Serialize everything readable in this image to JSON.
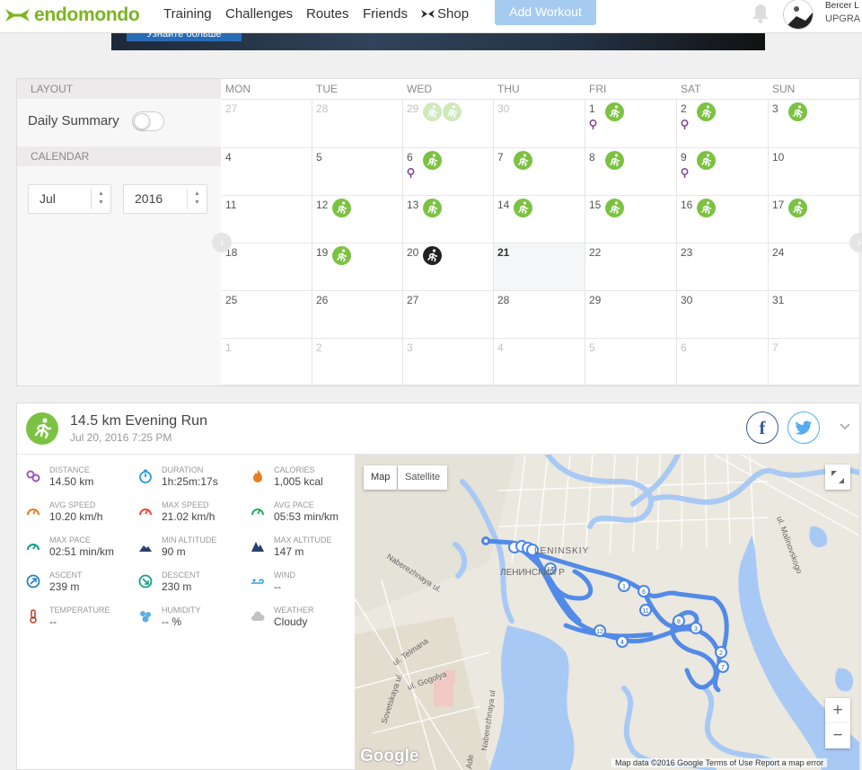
{
  "nav": {
    "brand": "endomondo",
    "links": [
      "Training",
      "Challenges",
      "Routes",
      "Friends"
    ],
    "shop": "Shop",
    "add_workout": "Add Workout",
    "user_name": "Bercer L",
    "user_upgrade": "UPGRA"
  },
  "banner": {
    "button_label": "Узнайте больше"
  },
  "calendar": {
    "layout_heading": "LAYOUT",
    "daily_summary_label": "Daily Summary",
    "daily_summary_on": false,
    "calendar_heading": "CALENDAR",
    "month": "Jul",
    "year": "2016",
    "weekdays": [
      "MON",
      "TUE",
      "WED",
      "THU",
      "FRI",
      "SAT",
      "SUN"
    ],
    "weeks": [
      [
        {
          "d": "27",
          "dim": true
        },
        {
          "d": "28",
          "dim": true
        },
        {
          "d": "29",
          "dim": true,
          "w": 2,
          "faded": true
        },
        {
          "d": "30",
          "dim": true
        },
        {
          "d": "1",
          "w": 1,
          "pin": true
        },
        {
          "d": "2",
          "w": 1,
          "pin": true
        },
        {
          "d": "3",
          "w": 1
        }
      ],
      [
        {
          "d": "4"
        },
        {
          "d": "5"
        },
        {
          "d": "6",
          "w": 1,
          "pin": true
        },
        {
          "d": "7",
          "w": 1
        },
        {
          "d": "8",
          "w": 1
        },
        {
          "d": "9",
          "w": 1,
          "pin": true
        },
        {
          "d": "10"
        }
      ],
      [
        {
          "d": "11"
        },
        {
          "d": "12",
          "w": 1
        },
        {
          "d": "13",
          "w": 1
        },
        {
          "d": "14",
          "w": 1
        },
        {
          "d": "15",
          "w": 1
        },
        {
          "d": "16",
          "w": 1
        },
        {
          "d": "17",
          "w": 1
        }
      ],
      [
        {
          "d": "18"
        },
        {
          "d": "19",
          "w": 1
        },
        {
          "d": "20",
          "w": 1,
          "dark": true
        },
        {
          "d": "21",
          "today": true
        },
        {
          "d": "22"
        },
        {
          "d": "23"
        },
        {
          "d": "24"
        }
      ],
      [
        {
          "d": "25"
        },
        {
          "d": "26"
        },
        {
          "d": "27"
        },
        {
          "d": "28"
        },
        {
          "d": "29"
        },
        {
          "d": "30"
        },
        {
          "d": "31"
        }
      ],
      [
        {
          "d": "1",
          "dim": true
        },
        {
          "d": "2",
          "dim": true
        },
        {
          "d": "3",
          "dim": true
        },
        {
          "d": "4",
          "dim": true
        },
        {
          "d": "5",
          "dim": true
        },
        {
          "d": "6",
          "dim": true
        },
        {
          "d": "7",
          "dim": true
        }
      ]
    ]
  },
  "workout": {
    "title": "14.5 km Evening Run",
    "date": "Jul 20, 2016 7:25 PM",
    "stats": [
      {
        "icon": "distance-icon",
        "label": "DISTANCE",
        "value": "14.50 km",
        "color": "#9b59b6"
      },
      {
        "icon": "duration-icon",
        "label": "DURATION",
        "value": "1h:25m:17s",
        "color": "#3498db"
      },
      {
        "icon": "calories-icon",
        "label": "CALORIES",
        "value": "1,005 kcal",
        "color": "#e67e22"
      },
      {
        "icon": "avg-speed-icon",
        "label": "AVG SPEED",
        "value": "10.20 km/h",
        "color": "#e67e22"
      },
      {
        "icon": "max-speed-icon",
        "label": "MAX SPEED",
        "value": "21.02 km/h",
        "color": "#e74c3c"
      },
      {
        "icon": "avg-pace-icon",
        "label": "AVG PACE",
        "value": "05:53 min/km",
        "color": "#27ae60"
      },
      {
        "icon": "max-pace-icon",
        "label": "MAX PACE",
        "value": "02:51 min/km",
        "color": "#16a085"
      },
      {
        "icon": "min-altitude-icon",
        "label": "MIN ALTITUDE",
        "value": "90 m",
        "color": "#2c3e70"
      },
      {
        "icon": "max-altitude-icon",
        "label": "MAX ALTITUDE",
        "value": "147 m",
        "color": "#2c3e70"
      },
      {
        "icon": "ascent-icon",
        "label": "ASCENT",
        "value": "239 m",
        "color": "#2980b9"
      },
      {
        "icon": "descent-icon",
        "label": "DESCENT",
        "value": "230 m",
        "color": "#16a085"
      },
      {
        "icon": "wind-icon",
        "label": "WIND",
        "value": "--",
        "color": "#3498db"
      },
      {
        "icon": "temperature-icon",
        "label": "TEMPERATURE",
        "value": "--",
        "color": "#c0392b"
      },
      {
        "icon": "humidity-icon",
        "label": "HUMIDITY",
        "value": "-- %",
        "color": "#5dade2"
      },
      {
        "icon": "weather-icon",
        "label": "WEATHER",
        "value": "Cloudy",
        "color": "#bdc3c7"
      }
    ]
  },
  "map": {
    "tab_map": "Map",
    "tab_satellite": "Satellite",
    "attribution": "Map data ©2016 Google   Terms of Use   Report a map error",
    "google": "Google",
    "labels": [
      "LENINSKIY",
      "ЛЕНИНСКИЙ Р",
      "ul. Malinovskogo",
      "Naberezhnaya ul.",
      "ul. Telmana",
      "Sovetskaya ul.",
      "ul. Gogolya",
      "Naberezhnaya ul",
      "Ade"
    ],
    "markers": [
      "1",
      "2",
      "3",
      "4",
      "5",
      "6",
      "7",
      "8",
      "11",
      "12",
      "14"
    ]
  }
}
